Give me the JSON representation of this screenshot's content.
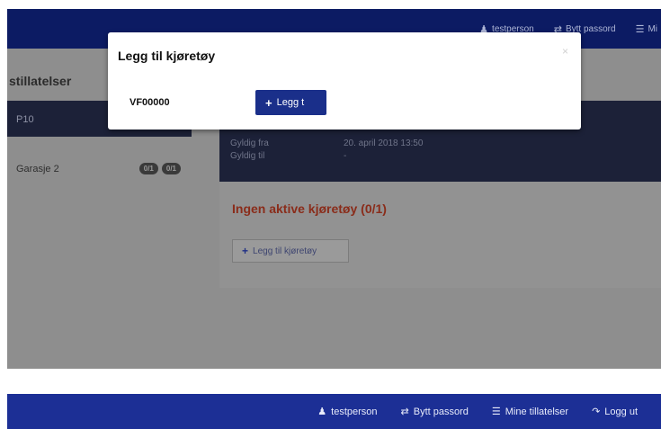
{
  "colors": {
    "navbar": "#1c2f95",
    "modal_button": "#1a2f8a",
    "warning_text": "#8a2c1a"
  },
  "top_nav": {
    "user": "testperson",
    "change_password": "Bytt passord",
    "permits": "Mi"
  },
  "sidebar": {
    "title": "stillatelser",
    "active_item": "P10",
    "items": [
      {
        "label": "Garasje 2",
        "badges": [
          "0/1",
          "0/1"
        ]
      }
    ]
  },
  "permit_panel": {
    "valid_from_label": "Gyldig fra",
    "valid_from_value": "20. april 2018 13:50",
    "valid_to_label": "Gyldig til",
    "valid_to_value": "-"
  },
  "vehicles": {
    "none_active": "Ingen aktive kjøretøy (0/1)",
    "add_label": "Legg til kjøretøy"
  },
  "modal": {
    "title": "Legg til kjøretøy",
    "plate_value": "VF00000",
    "add_button": "Legg t"
  },
  "bottom_nav": {
    "user": "testperson",
    "change_password": "Bytt passord",
    "permits": "Mine tillatelser",
    "logout": "Logg ut"
  },
  "icons": {
    "user": "user-icon",
    "shuffle": "shuffle-icon",
    "list": "list-icon",
    "logout": "logout-icon",
    "plus": "plus-icon",
    "close": "close-icon"
  }
}
